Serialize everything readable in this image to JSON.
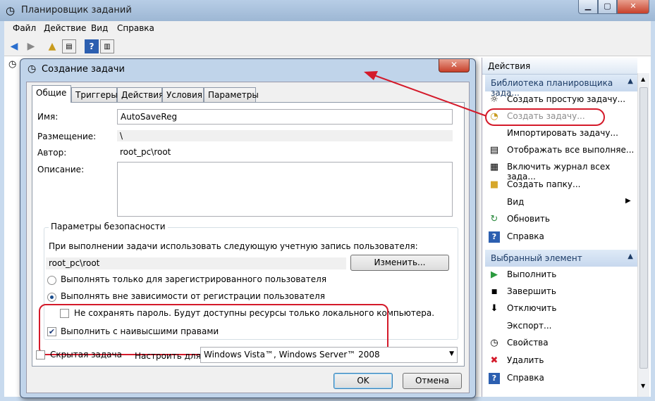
{
  "app": {
    "title": "Планировщик заданий",
    "min": "▁",
    "max": "▢",
    "close": "✕"
  },
  "menu": [
    "Файл",
    "Действие",
    "Вид",
    "Справка"
  ],
  "dialog": {
    "title": "Создание задачи",
    "close": "✕",
    "tabs": [
      "Общие",
      "Триггеры",
      "Действия",
      "Условия",
      "Параметры"
    ],
    "name_label": "Имя:",
    "name_value": "AutoSaveReg",
    "location_label": "Размещение:",
    "location_value": "\\",
    "author_label": "Автор:",
    "author_value": "root_pc\\root",
    "description_label": "Описание:",
    "description_value": "",
    "security": {
      "title": "Параметры безопасности",
      "account_prompt": "При выполнении задачи использовать следующую учетную запись пользователя:",
      "account_value": "root_pc\\root",
      "change_button": "Изменить...",
      "radio_logged_on": "Выполнять только для зарегистрированного пользователя",
      "radio_always": "Выполнять вне зависимости от регистрации пользователя",
      "dont_store_password": "Не сохранять пароль. Будут доступны ресурсы только локального компьютера.",
      "highest_privileges": "Выполнить с наивысшими правами"
    },
    "hidden_label": "Скрытая задача",
    "configure_label": "Настроить для:",
    "configure_value": "Windows Vista™, Windows Server™ 2008",
    "ok": "OK",
    "cancel": "Отмена"
  },
  "actions": {
    "header": "Действия",
    "library_section": "Библиотека планировщика зада...",
    "library_items": [
      "Создать простую задачу...",
      "Создать задачу...",
      "Импортировать задачу...",
      "Отображать все выполняе...",
      "Включить журнал всех зада...",
      "Создать папку...",
      "Вид",
      "Обновить",
      "Справка"
    ],
    "selected_section": "Выбранный элемент",
    "selected_items": [
      "Выполнить",
      "Завершить",
      "Отключить",
      "Экспорт...",
      "Свойства",
      "Удалить",
      "Справка"
    ]
  },
  "colors": {
    "annotation": "#d41a2a",
    "titlebar": "#9db7d4"
  }
}
